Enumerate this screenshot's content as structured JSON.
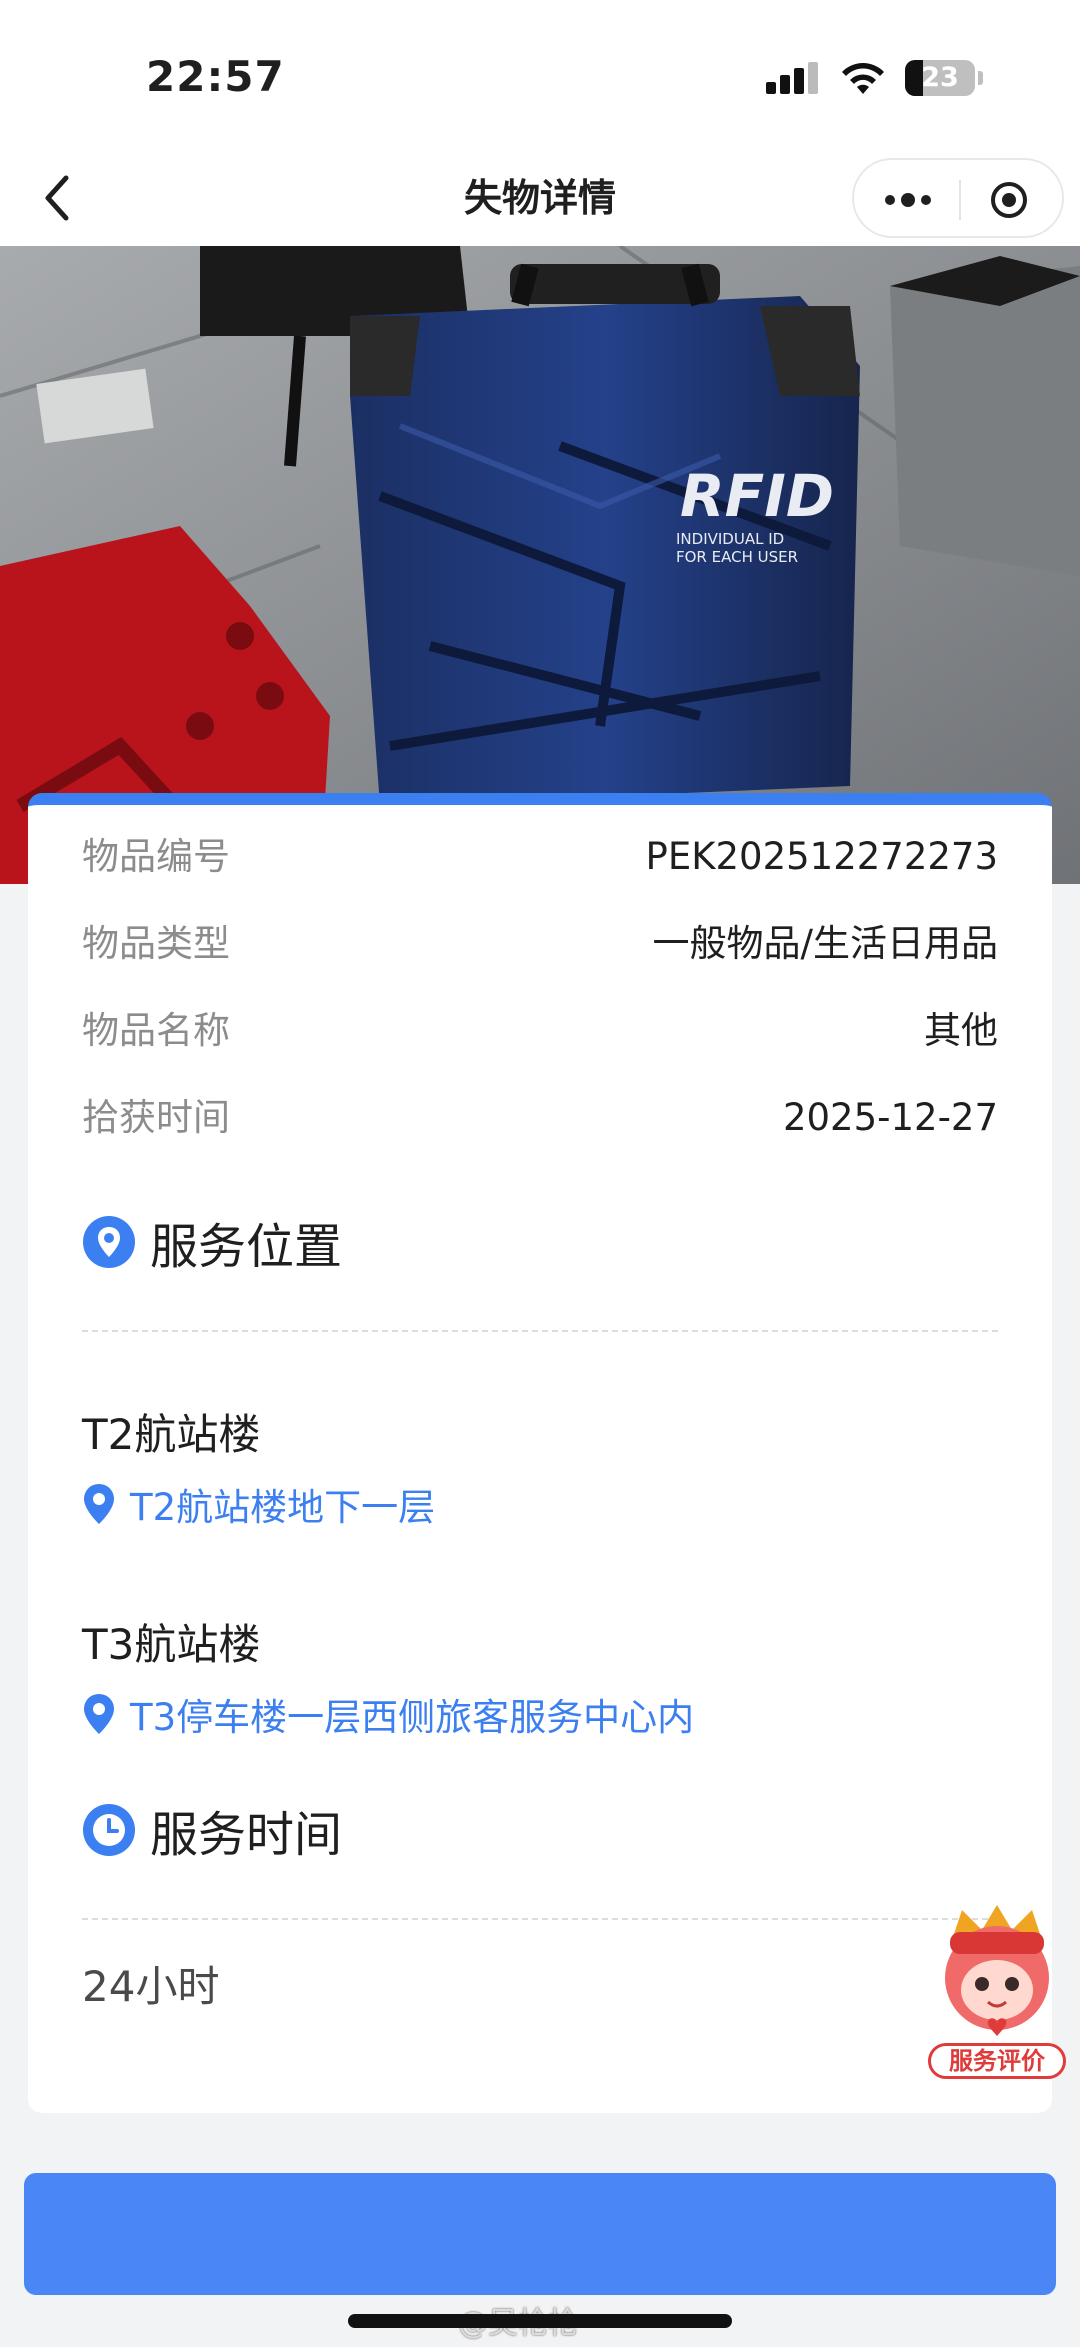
{
  "status_bar": {
    "time": "22:57",
    "battery": "23"
  },
  "nav": {
    "title": "失物详情"
  },
  "item": {
    "fields": [
      {
        "label": "物品编号",
        "value": "PEK202512272273"
      },
      {
        "label": "物品类型",
        "value": "一般物品/生活日用品"
      },
      {
        "label": "物品名称",
        "value": "其他"
      },
      {
        "label": "拾获时间",
        "value": "2025-12-27"
      }
    ],
    "photo_text": {
      "logo": "RFID",
      "line1": "INDIVIDUAL ID",
      "line2": "FOR EACH USER"
    }
  },
  "service_location": {
    "title": "服务位置",
    "terminals": [
      {
        "name": "T2航站楼",
        "location": "T2航站楼地下一层"
      },
      {
        "name": "T3航站楼",
        "location": "T3停车楼一层西侧旅客服务中心内"
      }
    ]
  },
  "service_time": {
    "title": "服务时间",
    "hours": "24小时"
  },
  "floating": {
    "label": "服务评价"
  },
  "bottom": {
    "watermark": "@吴枪枪"
  },
  "colors": {
    "accent": "#3c7ff0",
    "button": "#4b86f7",
    "card_top": "#3c7ff0"
  }
}
